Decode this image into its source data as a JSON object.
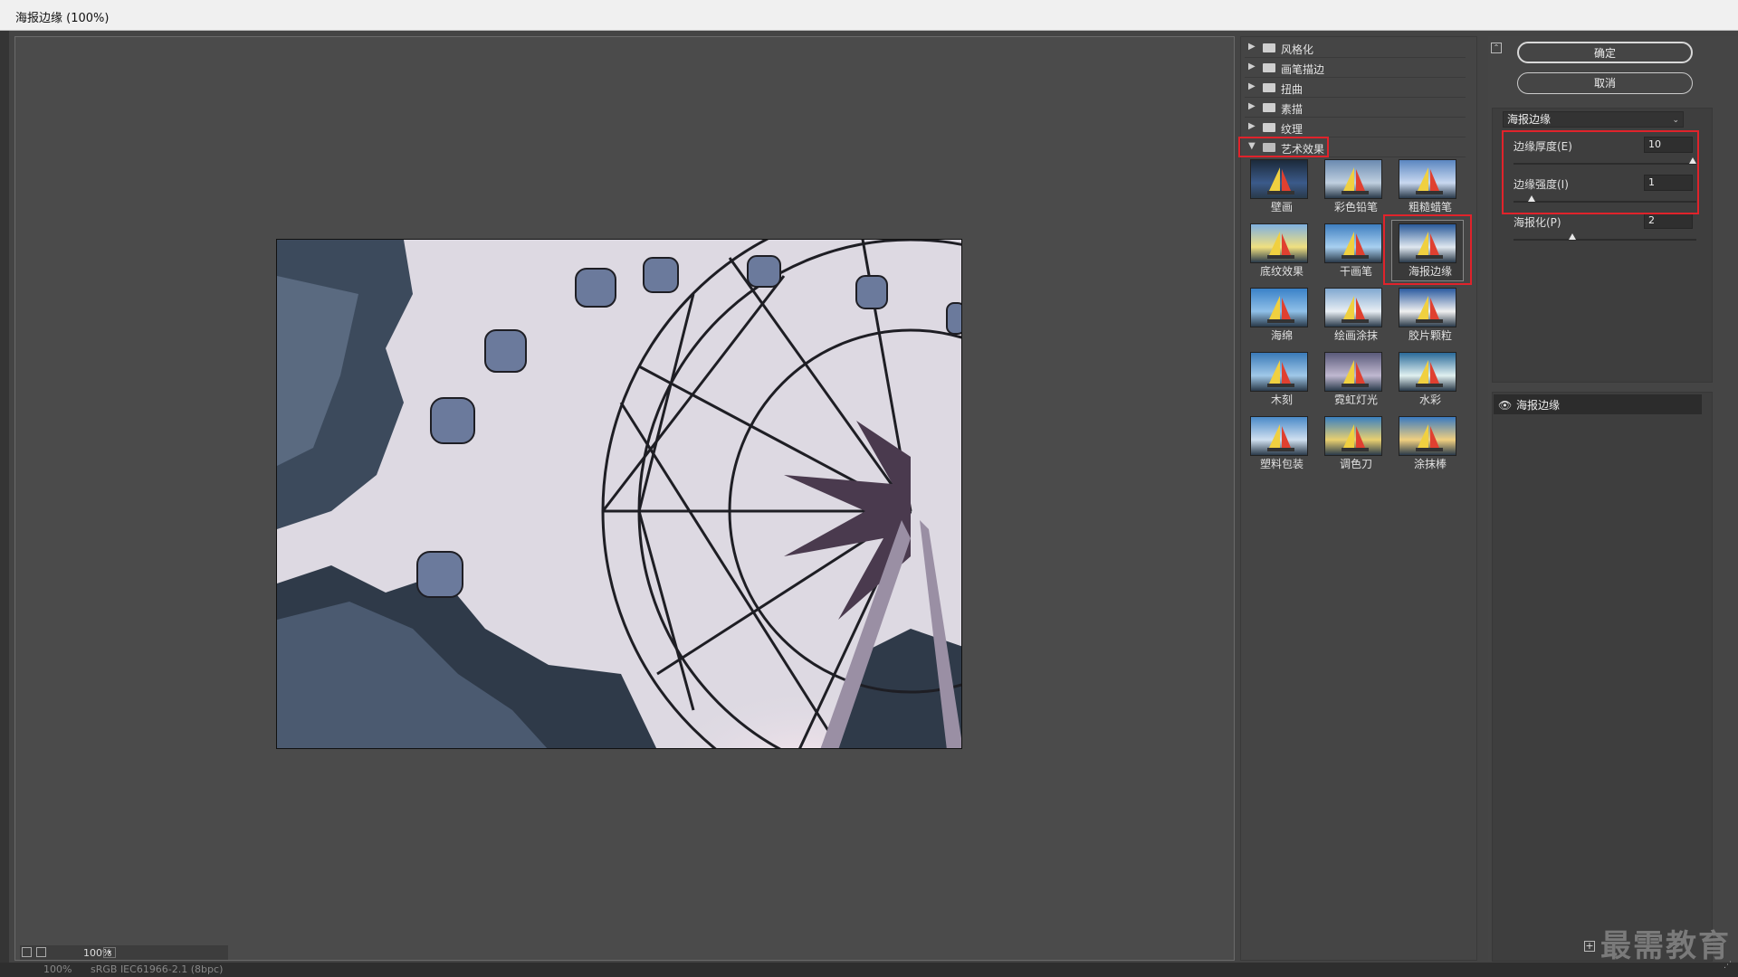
{
  "window": {
    "title": "海报边缘 (100%)"
  },
  "canvas": {
    "zoom": "100%",
    "color_profile": "sRGB IEC61966-2.1 (8bpc)",
    "status_zoom": "100%"
  },
  "gallery": {
    "categories": [
      {
        "label": "风格化",
        "expanded": false
      },
      {
        "label": "画笔描边",
        "expanded": false
      },
      {
        "label": "扭曲",
        "expanded": false
      },
      {
        "label": "素描",
        "expanded": false
      },
      {
        "label": "纹理",
        "expanded": false
      },
      {
        "label": "艺术效果",
        "expanded": true
      }
    ],
    "filters": [
      "壁画",
      "彩色铅笔",
      "粗糙蜡笔",
      "底纹效果",
      "干画笔",
      "海报边缘",
      "海绵",
      "绘画涂抹",
      "胶片颗粒",
      "木刻",
      "霓虹灯光",
      "水彩",
      "塑料包装",
      "调色刀",
      "涂抹棒"
    ],
    "selected_filter": "海报边缘"
  },
  "buttons": {
    "ok": "确定",
    "cancel": "取消"
  },
  "settings": {
    "filter_select": "海报边缘",
    "params": [
      {
        "label": "边缘厚度(E)",
        "value": "10",
        "level": 1.0
      },
      {
        "label": "边缘强度(I)",
        "value": "1",
        "level": 0.1
      },
      {
        "label": "海报化(P)",
        "value": "2",
        "level": 0.33
      }
    ]
  },
  "layers": {
    "items": [
      {
        "name": "海报边缘",
        "visible": true
      }
    ]
  },
  "watermark": "最需教育",
  "colors": {
    "highlight": "#e0232b",
    "background": "#444444",
    "canvas_bg": "#4b4b4b"
  }
}
